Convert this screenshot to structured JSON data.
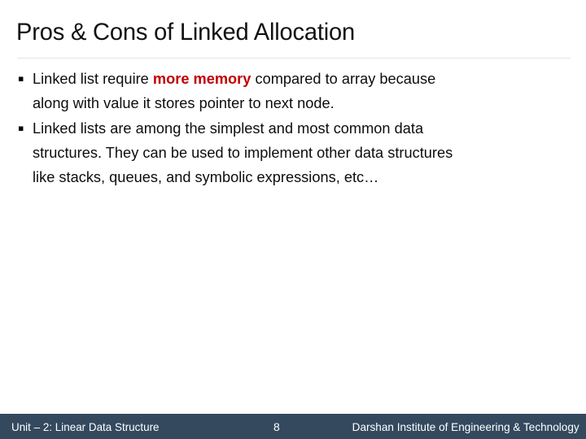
{
  "slide": {
    "title": "Pros & Cons of Linked Allocation",
    "bullet_marker": "▪",
    "accent_red": "#c00000",
    "footer_bar_color": "#34495e",
    "divider_color": "#e2e2e2"
  },
  "body": {
    "bullets": [
      {
        "marker": "▪",
        "line1_pre": "Linked list require ",
        "highlight": "more memory",
        "line1_post": " compared to array because",
        "line2": "along with value it stores pointer to next node."
      },
      {
        "marker": "▪",
        "line1": "Linked lists are among the simplest and most common data",
        "line2": "structures. They can be used to implement other data structures",
        "line3": "like stacks, queues, and symbolic expressions, etc…"
      }
    ]
  },
  "footer": {
    "unit": "Unit – 2: Linear Data Structure",
    "page_number": "8",
    "institute": "Darshan Institute of Engineering & Technology"
  }
}
